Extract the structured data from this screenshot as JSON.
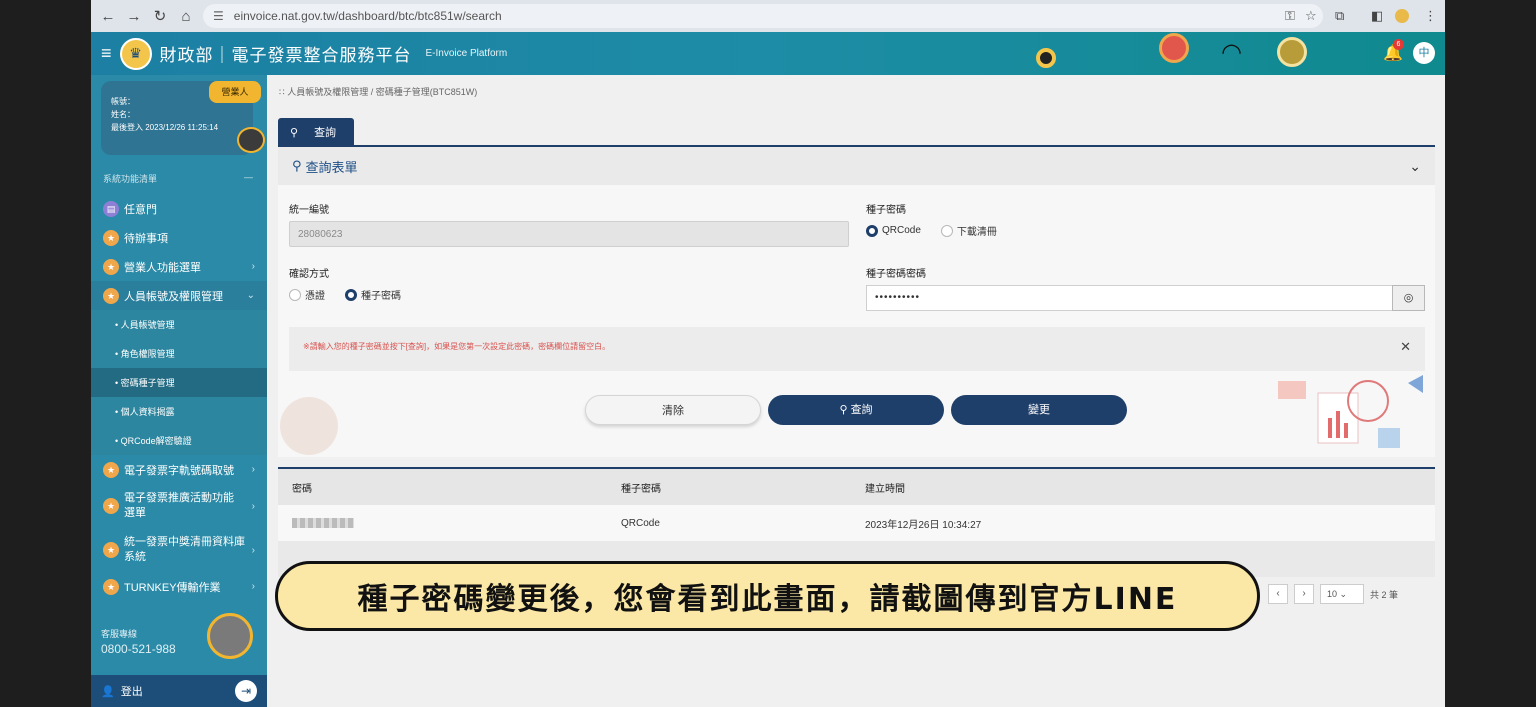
{
  "browser": {
    "url": "einvoice.nat.gov.tw/dashboard/btc/btc851w/search",
    "icons": [
      "back-icon",
      "forward-icon",
      "reload-icon",
      "home-icon",
      "tune-icon",
      "key-icon",
      "star-icon",
      "extensions-icon",
      "sidepanel-icon",
      "profile-icon",
      "menu-icon"
    ]
  },
  "header": {
    "logo_glyph": "♛",
    "title": "財政部｜電子發票整合服務平台",
    "subtitle": "E-Invoice Platform",
    "bell_count": "6",
    "lang": "中"
  },
  "sidebar": {
    "badge": "營業人",
    "account_label": "帳號：",
    "name_label": "姓名：",
    "last_login": "最後登入 2023/12/26 11:25:14",
    "section_label": "系統功能清單",
    "section_toggle": "—",
    "items": [
      {
        "label": "任意門",
        "icon": "door-icon"
      },
      {
        "label": "待辦事項",
        "icon": "star-icon"
      },
      {
        "label": "營業人功能選單",
        "icon": "star-icon",
        "chevron": "›"
      },
      {
        "label": "人員帳號及權限管理",
        "icon": "star-icon",
        "chevron": "⌄"
      }
    ],
    "subitems": [
      "• 人員帳號管理",
      "• 角色權限管理",
      "• 密碼種子管理",
      "• 個人資料揭露",
      "• QRCode解密驗證"
    ],
    "items2": [
      {
        "label": "電子發票字軌號碼取號",
        "chevron": "›"
      },
      {
        "label": "電子發票推廣活動功能選單",
        "chevron": "›"
      },
      {
        "label": "統一發票中獎清冊資料庫系統",
        "chevron": "›"
      },
      {
        "label": "TURNKEY傳輸作業",
        "chevron": "›"
      }
    ],
    "hotline_label": "客服專線",
    "hotline_number": "0800-521-988",
    "logout": "登出"
  },
  "main": {
    "breadcrumb": "∷ 人員帳號及權限管理  /  密碼種子管理(BTC851W)",
    "tab_label": "查詢",
    "form_title": "查詢表單",
    "fields": {
      "uni_label": "統一編號",
      "uni_value": "28080623",
      "seed_label": "種子密碼",
      "seed_opt1": "QRCode",
      "seed_opt2": "下載清冊",
      "verify_label": "確認方式",
      "verify_opt1": "憑證",
      "verify_opt2": "種子密碼",
      "seed_pw_label": "種子密碼密碼",
      "seed_pw_value": "••••••••••"
    },
    "notice": "※請輸入您的種子密碼並按下[查詢]，如果是您第一次設定此密碼，密碼欄位請留空白。",
    "buttons": {
      "clear": "清除",
      "query": "查詢",
      "change": "變更"
    },
    "table": {
      "headers": [
        "密碼",
        "種子密碼",
        "建立時間"
      ],
      "rows": [
        {
          "password": "",
          "seed": "QRCode",
          "created": "2023年12月26日 10:34:27"
        }
      ]
    },
    "pager": {
      "page": "/ 1",
      "page_size": "10",
      "total": "共 2 筆"
    }
  },
  "caption": "種子密碼變更後，您會看到此畫面，請截圖傳到官方LINE"
}
